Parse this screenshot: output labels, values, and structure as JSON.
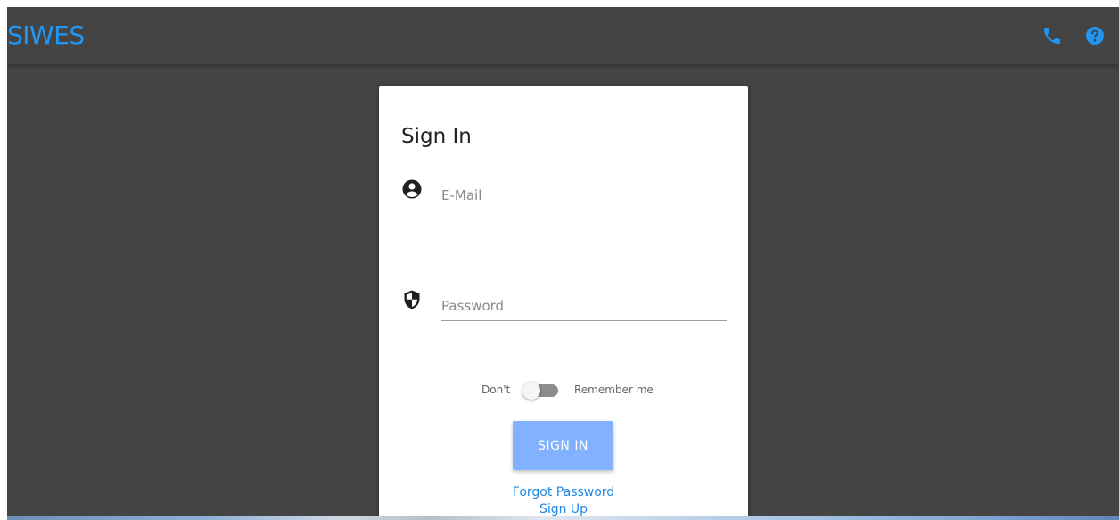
{
  "header": {
    "brand": "SIWES",
    "icons": [
      "phone-icon",
      "help-icon"
    ]
  },
  "colors": {
    "background": "#444444",
    "brand": "#2196f3",
    "link": "#1e88e5",
    "button": "#82b1ff"
  },
  "signin": {
    "title": "Sign In",
    "email": {
      "placeholder": "E-Mail",
      "value": "",
      "icon": "account-circle-icon"
    },
    "password": {
      "placeholder": "Password",
      "value": "",
      "icon": "security-shield-icon"
    },
    "remember": {
      "off_label": "Don't",
      "on_label": "Remember me",
      "state": "off"
    },
    "button_label": "SIGN IN",
    "forgot_label": "Forgot Password",
    "signup_label": "Sign Up"
  }
}
